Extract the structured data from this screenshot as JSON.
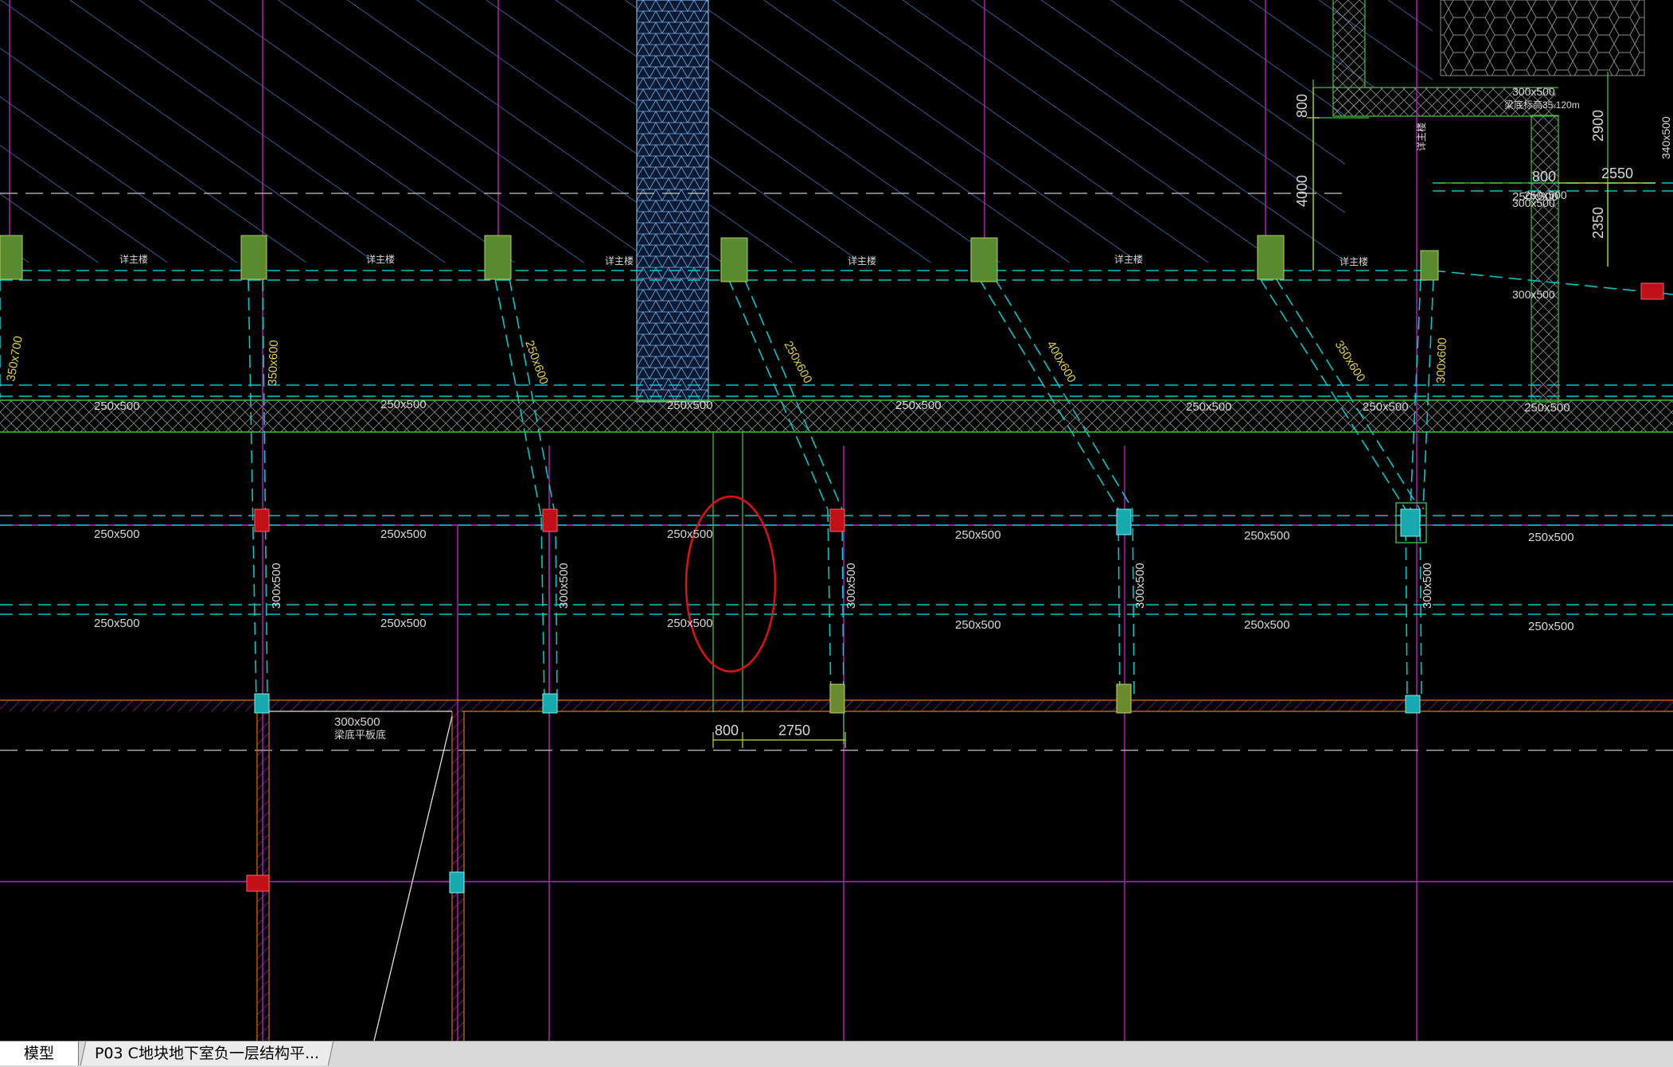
{
  "colors": {
    "background": "#000000",
    "hatch": "#3a74b8",
    "axis_magenta": "#c020c0",
    "beam_cyan": "#00c8c8",
    "wall_green": "#40c040",
    "column_red": "#d0101a",
    "column_green": "#6a9a3a",
    "column_cyan": "#18b0b8",
    "annotation_circle": "#e01010",
    "dimension": "#b8e030",
    "tab_bg": "#d9d9d9"
  },
  "labels": {
    "beam_upper": [
      "250x500",
      "250x500",
      "250x500",
      "250x500",
      "250x500",
      "250x500",
      "250x500",
      "250x500"
    ],
    "beam_mid": [
      "250x500",
      "250x500",
      "250x500",
      "250x500",
      "250x500",
      "250x500"
    ],
    "beam_low": [
      "250x500",
      "250x500",
      "250x500",
      "250x500",
      "250x500",
      "250x500"
    ],
    "diag_beams": [
      "350x700",
      "350x600",
      "250x600",
      "250x600",
      "400x600",
      "350x600",
      "300x600"
    ],
    "vert_beams": [
      "300x500",
      "300x500",
      "300x500",
      "300x500",
      "300x500"
    ],
    "detail_note": [
      "详主楼",
      "详主楼",
      "详主楼",
      "详主楼",
      "详主楼",
      "详主楼",
      "详主楼"
    ],
    "side_beam_1": "300x500",
    "side_beam_2": "250x500",
    "side_beam_3": "300x500",
    "top_beam": "300x500",
    "top_elev": "梁底标高35.120m",
    "ramp_beam": "300x500",
    "ramp_note": "梁底平板底",
    "vertical_note": "详主楼",
    "edge_beam": "340x500"
  },
  "dims": {
    "d800_bottom": "800",
    "d2750": "2750",
    "d800_top": "800",
    "d4000": "4000",
    "d800_side": "800",
    "d2900": "2900",
    "d2550": "2550",
    "d2350": "2350"
  },
  "tabs": {
    "model": "模型",
    "layout": "P03 C地块地下室负一层结构平..."
  }
}
